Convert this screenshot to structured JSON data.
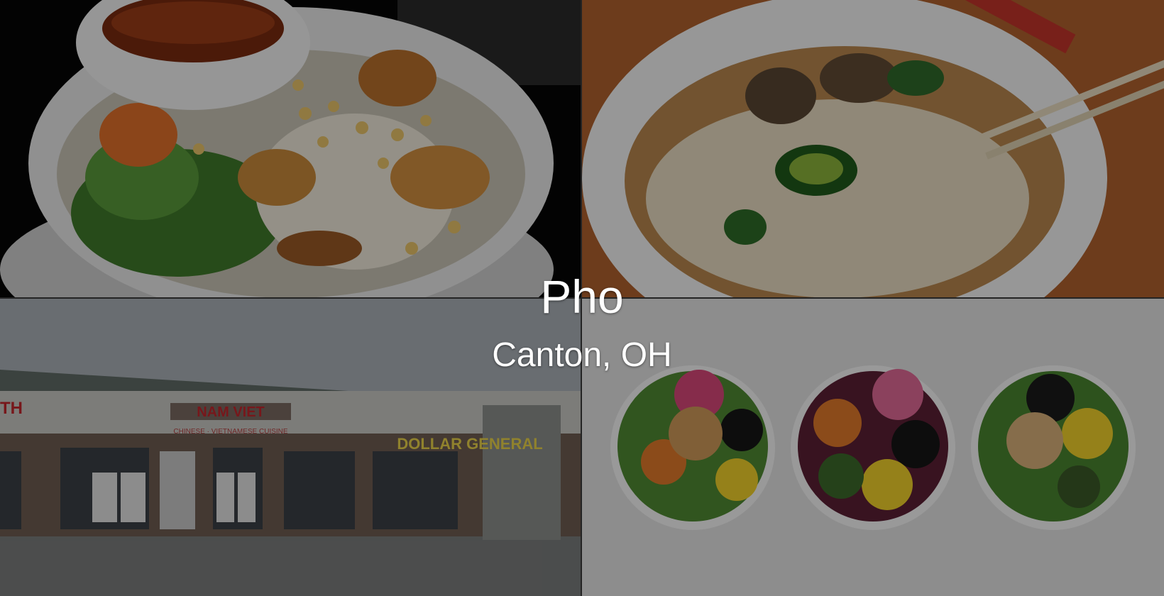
{
  "hero": {
    "title": "Pho",
    "location": "Canton, OH"
  },
  "tiles": [
    {
      "id": "vermicelli-bowl",
      "depicts": "vermicelli noodle bowl with grilled shrimp, peanuts, greens and dipping sauce"
    },
    {
      "id": "pho-soup",
      "depicts": "bowl of pho with rice noodles, meatballs, jalapeno and chopsticks"
    },
    {
      "id": "storefront",
      "depicts": "strip mall storefront"
    },
    {
      "id": "salad-bowls",
      "depicts": "three salad bowls with tofu, corn, black beans and vegetables"
    }
  ],
  "storefront_signs": {
    "restaurant": "NAM VIET",
    "restaurant_sub": "CHINESE · VIETNAMESE CUISINE",
    "neighbor": "DOLLAR GENERAL",
    "left_edge": "TH"
  },
  "colors": {
    "overlay": "#000000",
    "caption": "#ffffff",
    "sign_yellow": "#e8d24a",
    "sign_red": "#c0262c"
  }
}
